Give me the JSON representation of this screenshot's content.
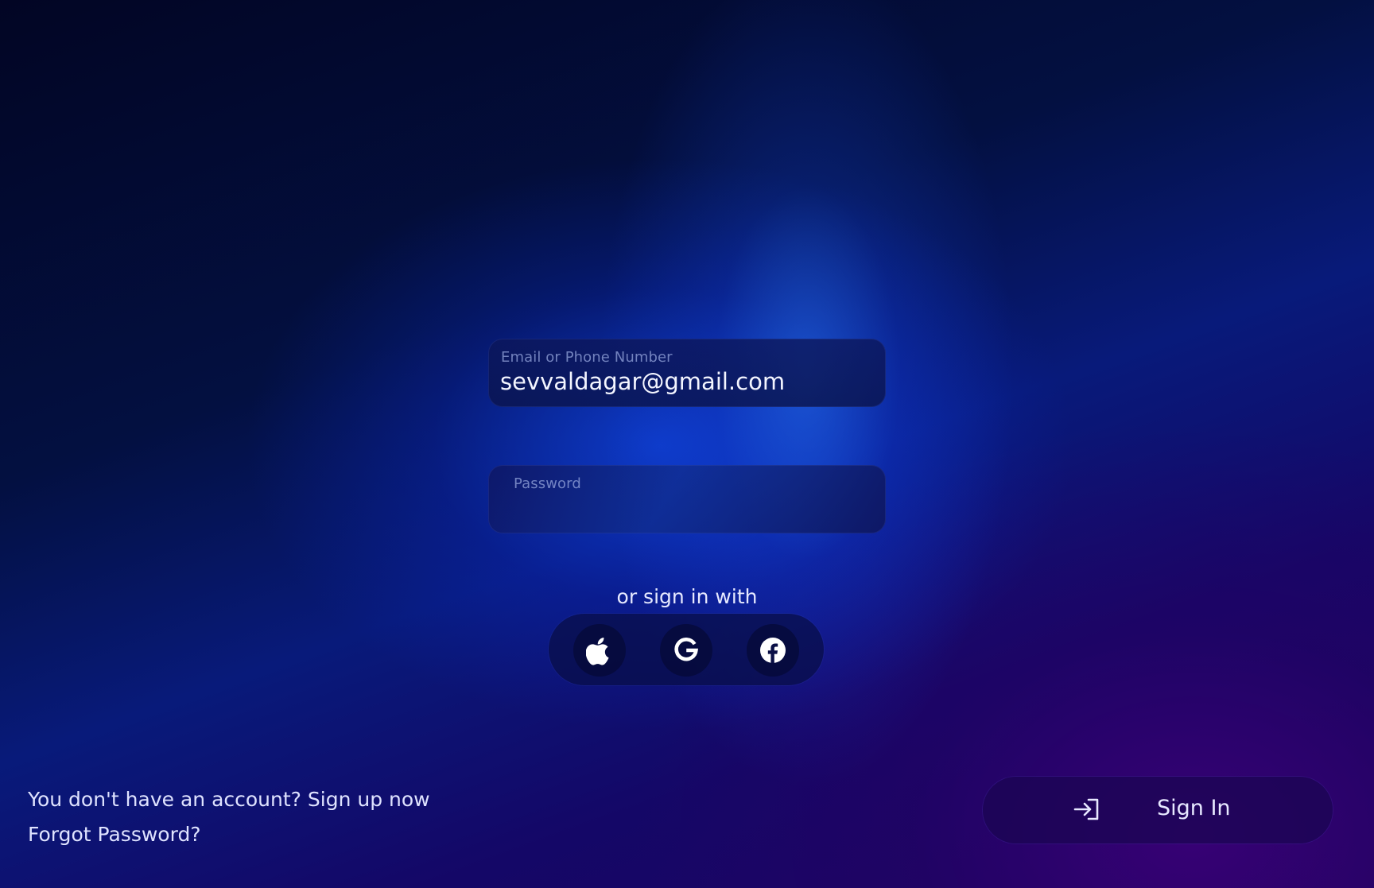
{
  "login": {
    "email": {
      "label": "Email or Phone Number",
      "value": "sevvaldagar@gmail.com"
    },
    "password": {
      "label": "Password",
      "value": ""
    },
    "social": {
      "caption": "or  sign in with",
      "providers": [
        {
          "name": "Apple",
          "icon": "apple-icon"
        },
        {
          "name": "Google",
          "icon": "google-icon"
        },
        {
          "name": "Facebook",
          "icon": "facebook-icon"
        }
      ]
    },
    "footer": {
      "signup_prompt": "You don't have an account? Sign up now",
      "forgot_password": "Forgot Password?"
    },
    "signin_button": {
      "label": "Sign In",
      "icon": "login-arrow-icon"
    }
  }
}
